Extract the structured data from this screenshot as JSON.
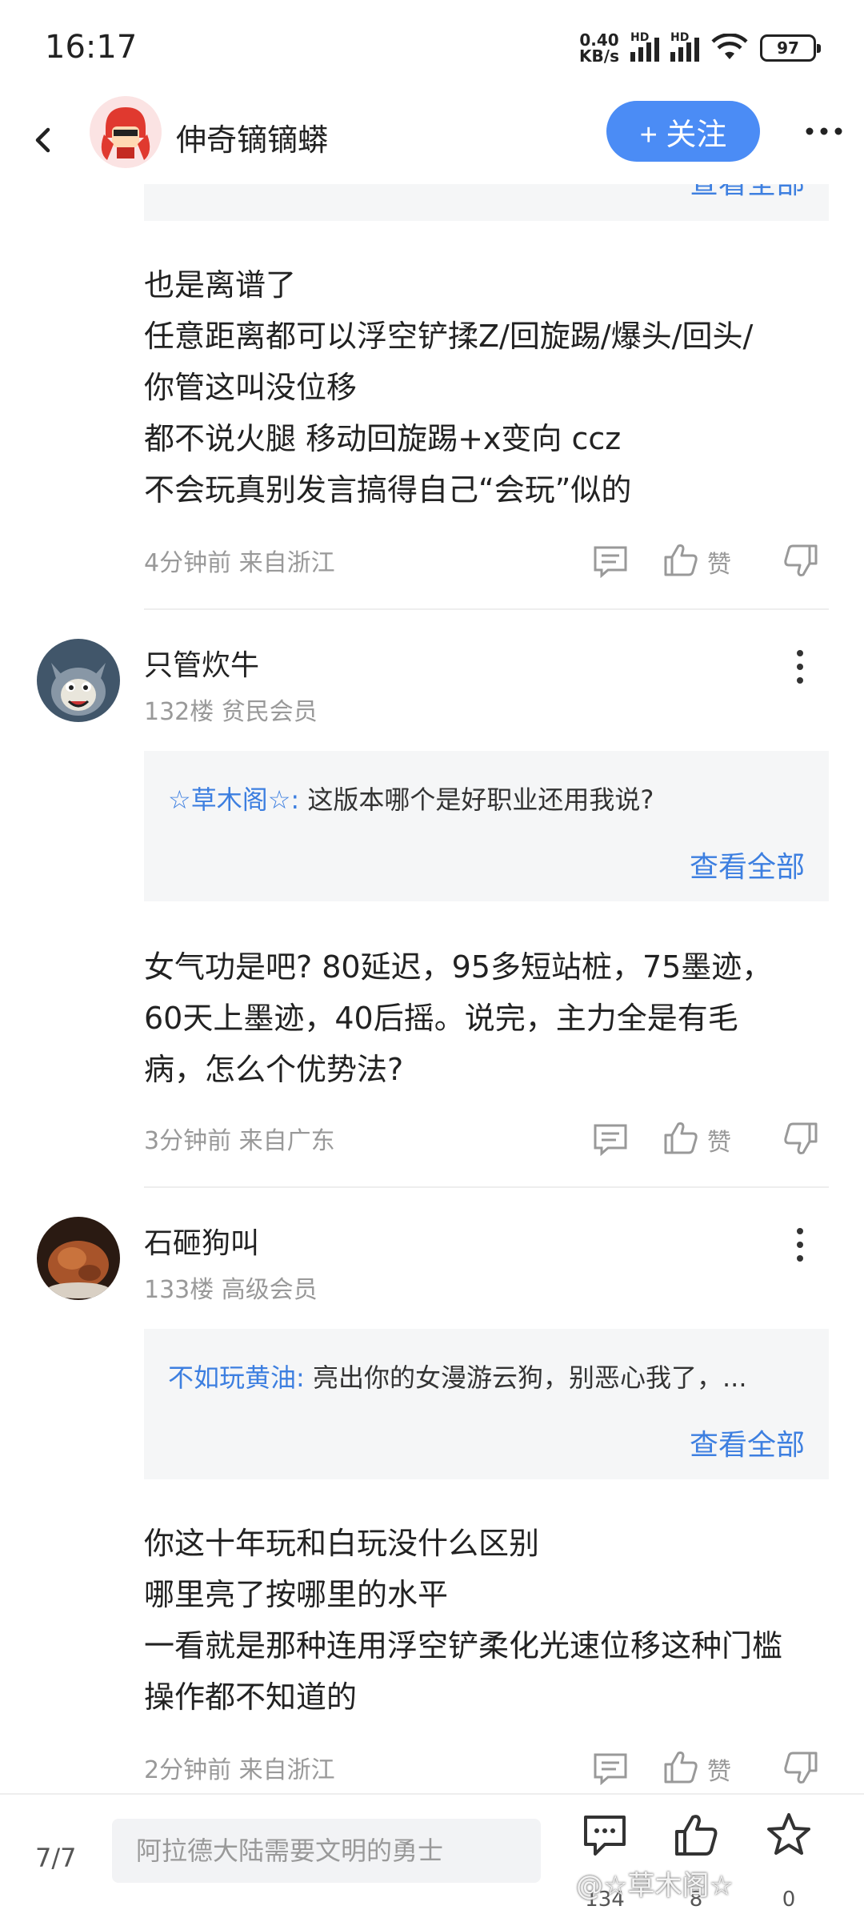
{
  "status_bar": {
    "time": "16:17",
    "net_speed": "0.40",
    "net_unit": "KB/s",
    "network_label": "HD",
    "battery": "97"
  },
  "header": {
    "name": "伸奇镝镝蟒",
    "follow_label": "+ 关注"
  },
  "top_cut": {
    "view_all": "查看全部"
  },
  "posts": [
    {
      "body": "也是离谱了\n任意距离都可以浮空铲揉Z/回旋踢/爆头/回头/\n你管这叫没位移\n都不说火腿 移动回旋踢+x变向 ccz\n不会玩真别发言搞得自己“会玩”似的",
      "meta": "4分钟前 来自浙江",
      "like_label": "赞"
    },
    {
      "user": "只管炊牛",
      "floor": "132楼 贫民会员",
      "quote_author": "☆草木阁☆:",
      "quote_text": " 这版本哪个是好职业还用我说?",
      "view_all": "查看全部",
      "body": "女气功是吧? 80延迟，95多短站桩，75墨迹，\n60天上墨迹，40后摇。说完，主力全是有毛\n病，怎么个优势法?",
      "meta": "3分钟前 来自广东",
      "like_label": "赞"
    },
    {
      "user": "石砸狗叫",
      "floor": "133楼 高级会员",
      "quote_author": "不如玩黄油:",
      "quote_text": " 亮出你的女漫游云狗，别恶心我了，...",
      "view_all": "查看全部",
      "body": "你这十年玩和白玩没什么区别\n哪里亮了按哪里的水平\n一看就是那种连用浮空铲柔化光速位移这种门槛\n操作都不知道的",
      "meta": "2分钟前 来自浙江",
      "like_label": "赞"
    }
  ],
  "bottom_bar": {
    "page": "7/7",
    "input_placeholder": "阿拉德大陆需要文明的勇士",
    "comment_count": "134",
    "like_count": "8",
    "star_count": "0",
    "watermark": "@☆草木阁☆"
  },
  "colors": {
    "accent": "#4b8cf5",
    "link": "#3d7fe0",
    "meta": "#999999",
    "quote_bg": "#f5f6f7"
  }
}
